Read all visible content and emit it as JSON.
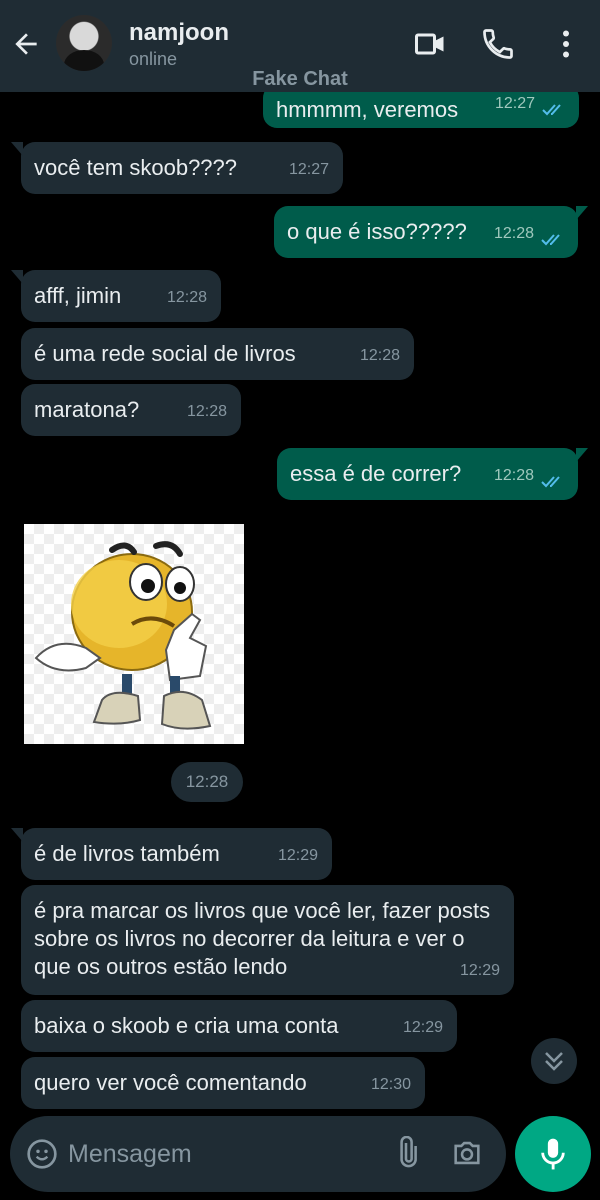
{
  "header": {
    "contact_name": "namjoon",
    "status": "online",
    "icons": [
      "back-arrow-icon",
      "video-call-icon",
      "phone-icon",
      "more-vert-icon"
    ]
  },
  "watermark": "Fake Chat",
  "messages": [
    {
      "dir": "out",
      "text": "hmmmm, veremos",
      "time": "12:27"
    },
    {
      "dir": "in",
      "text": "você tem skoob????",
      "time": "12:27"
    },
    {
      "dir": "out",
      "text": "o que é isso?????",
      "time": "12:28"
    },
    {
      "dir": "in",
      "text": "afff, jimin",
      "time": "12:28"
    },
    {
      "dir": "in",
      "text": "é uma rede social de livros",
      "time": "12:28"
    },
    {
      "dir": "in",
      "text": "maratona?",
      "time": "12:28"
    },
    {
      "dir": "out",
      "text": "essa é de correr?",
      "time": "12:28"
    },
    {
      "dir": "in",
      "text": "é de livros também",
      "time": "12:29"
    },
    {
      "dir": "in",
      "text": "é pra marcar os livros que você ler, fazer posts sobre os livros no decorrer da leitura e ver o que os outros estão lendo",
      "time": "12:29"
    },
    {
      "dir": "in",
      "text": "baixa o skoob e cria uma conta",
      "time": "12:29"
    },
    {
      "dir": "in",
      "text": "quero ver você comentando",
      "time": "12:30"
    }
  ],
  "sticker": {
    "time": "12:28"
  },
  "composer": {
    "placeholder": "Mensagem",
    "icons": [
      "emoji-icon",
      "attach-icon",
      "camera-icon",
      "mic-icon"
    ]
  },
  "colors": {
    "header_bg": "#1f2c34",
    "incoming_bubble": "#1f2c34",
    "outgoing_bubble": "#005c4b",
    "accent": "#00a884",
    "read_ticks": "#53bdeb"
  }
}
